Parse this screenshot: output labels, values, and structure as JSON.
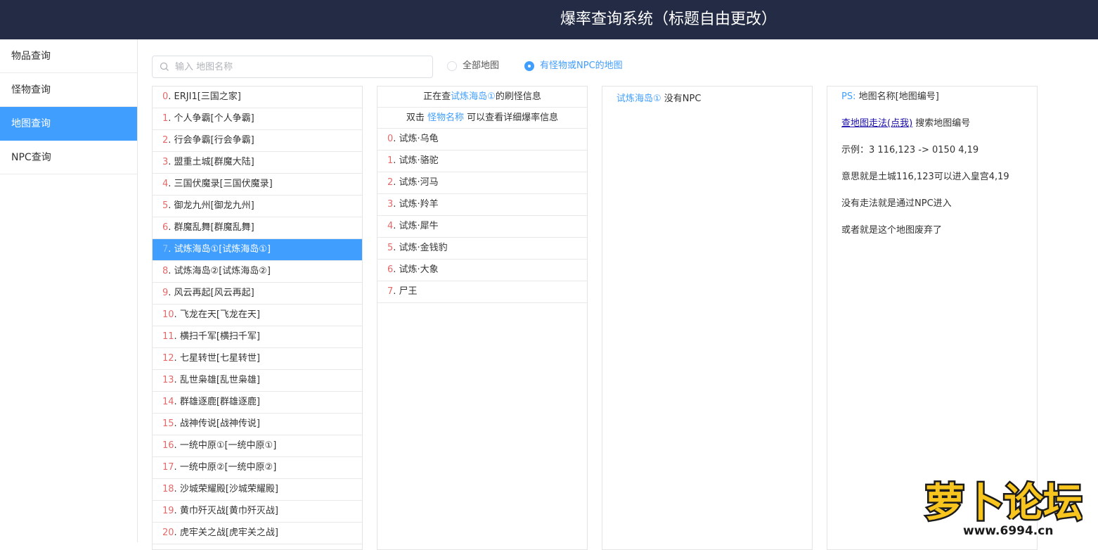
{
  "header": {
    "title": "爆率查询系统（标题自由更改）"
  },
  "sidebar": {
    "items": [
      {
        "label": "物品查询"
      },
      {
        "label": "怪物查询"
      },
      {
        "label": "地图查询"
      },
      {
        "label": "NPC查询"
      }
    ],
    "active": "地图查询"
  },
  "search": {
    "placeholder": "输入 地图名称",
    "value": ""
  },
  "filters": {
    "all_maps": "全部地图",
    "maps_with_monsters": "有怪物或NPC的地图",
    "selected": "有怪物或NPC的地图"
  },
  "maps": [
    {
      "idx": "0",
      "name": "ERJI1[三国之家]"
    },
    {
      "idx": "1",
      "name": "个人争霸[个人争霸]"
    },
    {
      "idx": "2",
      "name": "行会争霸[行会争霸]"
    },
    {
      "idx": "3",
      "name": "盟重土城[群魔大陆]"
    },
    {
      "idx": "4",
      "name": "三国伏魔录[三国伏魔录]"
    },
    {
      "idx": "5",
      "name": "御龙九州[御龙九州]"
    },
    {
      "idx": "6",
      "name": "群魔乱舞[群魔乱舞]"
    },
    {
      "idx": "7",
      "name": "试炼海岛①[试炼海岛①]"
    },
    {
      "idx": "8",
      "name": "试炼海岛②[试炼海岛②]"
    },
    {
      "idx": "9",
      "name": "风云再起[风云再起]"
    },
    {
      "idx": "10",
      "name": "飞龙在天[飞龙在天]"
    },
    {
      "idx": "11",
      "name": "横扫千军[横扫千军]"
    },
    {
      "idx": "12",
      "name": "七星转世[七星转世]"
    },
    {
      "idx": "13",
      "name": "乱世枭雄[乱世枭雄]"
    },
    {
      "idx": "14",
      "name": "群雄逐鹿[群雄逐鹿]"
    },
    {
      "idx": "15",
      "name": "战神传说[战神传说]"
    },
    {
      "idx": "16",
      "name": "一统中原①[一统中原①]"
    },
    {
      "idx": "17",
      "name": "一统中原②[一统中原②]"
    },
    {
      "idx": "18",
      "name": "沙城荣耀殿[沙城荣耀殿]"
    },
    {
      "idx": "19",
      "name": "黄巾歼灭战[黄巾歼灭战]"
    },
    {
      "idx": "20",
      "name": "虎牢关之战[虎牢关之战]"
    }
  ],
  "selected_map_index": "7",
  "monster_panel": {
    "line1_prefix": "正在查",
    "line1_map": "试炼海岛①",
    "line1_suffix": "的刷怪信息",
    "line2_prefix": "双击",
    "line2_link": "怪物名称",
    "line2_suffix": "可以查看详细爆率信息",
    "monsters": [
      {
        "idx": "0",
        "name": "试炼·乌龟"
      },
      {
        "idx": "1",
        "name": "试炼·骆驼"
      },
      {
        "idx": "2",
        "name": "试炼·河马"
      },
      {
        "idx": "3",
        "name": "试炼·羚羊"
      },
      {
        "idx": "4",
        "name": "试炼·犀牛"
      },
      {
        "idx": "5",
        "name": "试炼·金钱豹"
      },
      {
        "idx": "6",
        "name": "试炼·大象"
      },
      {
        "idx": "7",
        "name": "尸王"
      }
    ]
  },
  "npc_panel": {
    "map": "试炼海岛①",
    "text": "没有NPC"
  },
  "info_panel": {
    "ps_label": "PS:",
    "ps_text": "地图名称[地图编号]",
    "link_text": "查地图走法(点我)",
    "link_suffix": "搜索地图编号",
    "example": "示例：3 116,123 -> 0150 4,19",
    "meaning": "意思就是土城116,123可以进入皇宫4,19",
    "no_route": "没有走法就是通过NPC进入",
    "abandoned": "或者就是这个地图废弃了"
  },
  "watermark": {
    "text": "萝卜论坛",
    "site": "www.6994.cn"
  },
  "colors": {
    "header_bg": "#232b45",
    "accent": "#409eff",
    "index_red": "#e36a6a"
  }
}
